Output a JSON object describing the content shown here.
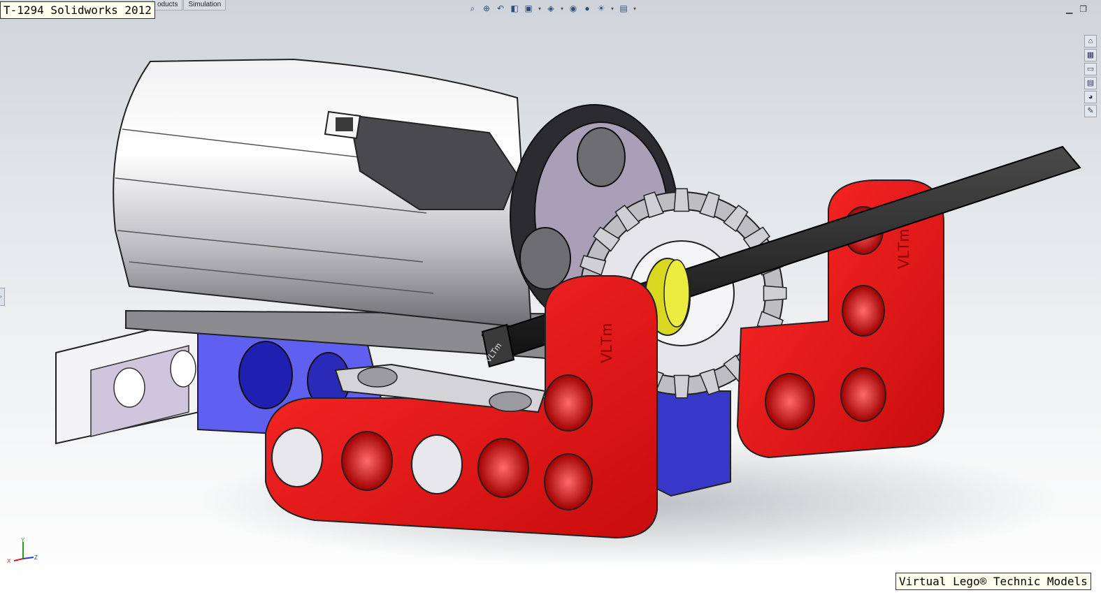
{
  "window": {
    "title_badge": "T-1294 Solidworks 2012"
  },
  "command_tabs": [
    "oducts",
    "Simulation"
  ],
  "headsup_toolbar": [
    "zoom-to-fit-icon",
    "zoom-to-area-icon",
    "previous-view-icon",
    "section-view-icon",
    "view-orientation-icon",
    "display-style-icon",
    "hide-show-items-icon",
    "edit-appearance-icon",
    "apply-scene-icon",
    "view-settings-icon"
  ],
  "window_controls": [
    "minimize-icon",
    "restore-icon"
  ],
  "task_pane": [
    "solidworks-resources-icon",
    "design-library-icon",
    "file-explorer-icon",
    "view-palette-icon",
    "appearances-scenes-icon",
    "custom-properties-icon"
  ],
  "model": {
    "liftarm_text": "VLTm",
    "axle_text": "VLTm",
    "colors": {
      "red": "#e01010",
      "blue": "#4040d8",
      "black": "#1a1a1a",
      "yellow": "#e0e020",
      "gray": "#9a9a9a",
      "light": "#e8e8ea"
    }
  },
  "triad": {
    "x": "X",
    "y": "Y",
    "z": "Z"
  },
  "credit": "Virtual Lego® Technic Models"
}
